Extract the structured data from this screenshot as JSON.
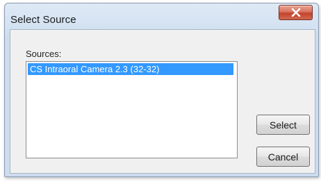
{
  "window": {
    "title": "Select Source",
    "close_icon": "close-x-icon"
  },
  "sources": {
    "label": "Sources:",
    "items": [
      {
        "label": "CS Intraoral Camera 2.3 (32-32)",
        "selected": true
      }
    ]
  },
  "buttons": {
    "select_label": "Select",
    "cancel_label": "Cancel"
  },
  "colors": {
    "selection": "#3399ff",
    "close_button": "#c4432d"
  }
}
